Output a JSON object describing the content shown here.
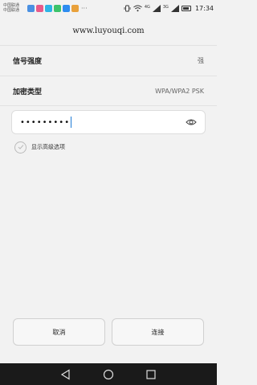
{
  "status": {
    "carrier_line1": "中国联通",
    "carrier_line2": "中国联通",
    "more": "···",
    "net_4g": "4G",
    "net_3g": "3G",
    "time": "17:34",
    "notif_colors": [
      "#4a90e2",
      "#e85a8a",
      "#2db4e6",
      "#3cc36b",
      "#2d8cf0",
      "#e9a13b"
    ]
  },
  "header": {
    "title": "www.luyouqi.com"
  },
  "signal": {
    "label": "信号强度",
    "value": "强"
  },
  "security": {
    "label": "加密类型",
    "value": "WPA/WPA2 PSK"
  },
  "password": {
    "value": "•••••••••"
  },
  "advanced": {
    "label": "显示高级选项"
  },
  "buttons": {
    "cancel": "取消",
    "connect": "连接"
  },
  "colors": {
    "cursor": "#1e7bd6",
    "nav_bg": "#1a1a1a"
  }
}
